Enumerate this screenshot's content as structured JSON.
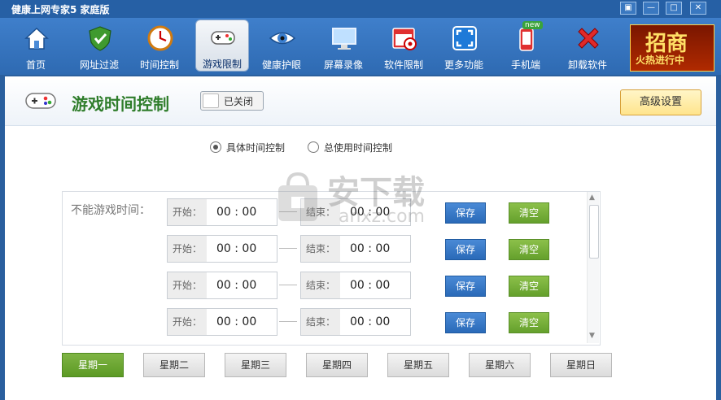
{
  "window": {
    "title": "健康上网专家5 家庭版",
    "controls": [
      "▣",
      "—",
      "□",
      "✕"
    ]
  },
  "toolbar": {
    "items": [
      {
        "label": "首页",
        "icon": "home-icon"
      },
      {
        "label": "网址过滤",
        "icon": "shield-icon"
      },
      {
        "label": "时间控制",
        "icon": "clock-icon"
      },
      {
        "label": "游戏限制",
        "icon": "gamepad-icon",
        "active": true
      },
      {
        "label": "健康护眼",
        "icon": "eye-icon"
      },
      {
        "label": "屏幕录像",
        "icon": "monitor-icon"
      },
      {
        "label": "软件限制",
        "icon": "software-block-icon"
      },
      {
        "label": "更多功能",
        "icon": "expand-icon"
      },
      {
        "label": "手机端",
        "icon": "phone-icon",
        "badge": "new"
      },
      {
        "label": "卸载软件",
        "icon": "uninstall-x-icon"
      }
    ],
    "ad": {
      "line1": "招商",
      "line2": "火热进行中"
    }
  },
  "header": {
    "title": "游戏时间控制",
    "toggle_label": "已关闭",
    "advanced_label": "高级设置"
  },
  "mode": {
    "options": [
      "具体时间控制",
      "总使用时间控制"
    ],
    "selected": 0
  },
  "schedule": {
    "label": "不能游戏时间：",
    "start_label": "开始：",
    "end_label": "结束：",
    "rows": [
      {
        "start": "00 : 00",
        "end": "00 : 00"
      },
      {
        "start": "00 : 00",
        "end": "00 : 00"
      },
      {
        "start": "00 : 00",
        "end": "00 : 00"
      },
      {
        "start": "00 : 00",
        "end": "00 : 00"
      }
    ],
    "save_label": "保存",
    "clear_label": "清空"
  },
  "days": {
    "items": [
      "星期一",
      "星期二",
      "星期三",
      "星期四",
      "星期五",
      "星期六",
      "星期日"
    ],
    "selected": 0
  },
  "watermark": {
    "text": "安下载",
    "sub": "anxz.com"
  },
  "colors": {
    "toolbar": "#2e6ab2",
    "title_green": "#2f7d2b",
    "save_blue": "#2a6ab8",
    "clear_green": "#64a02c",
    "day_active": "#5c9a24",
    "adv_yellow": "#ffe48c"
  }
}
